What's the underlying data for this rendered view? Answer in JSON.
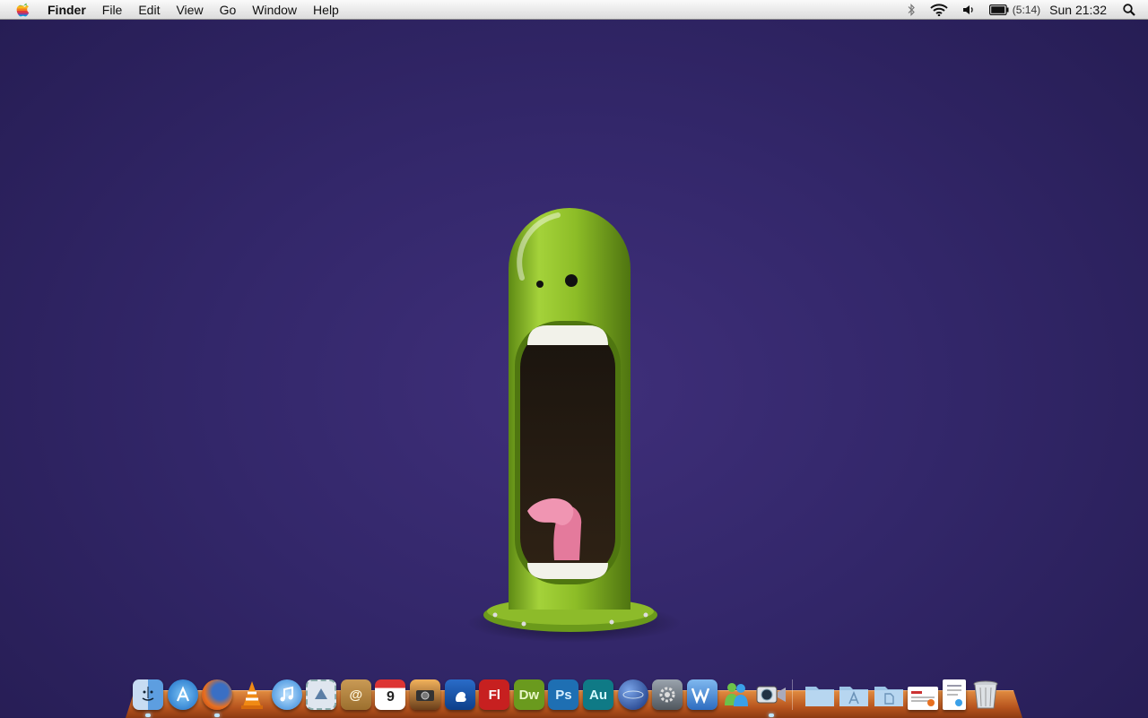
{
  "menubar": {
    "app_name": "Finder",
    "items": [
      "File",
      "Edit",
      "View",
      "Go",
      "Window",
      "Help"
    ],
    "status": {
      "battery_time": "(5:14)",
      "clock": "Sun 21:32"
    }
  },
  "dock": {
    "apps": [
      {
        "name": "Finder",
        "icon": "finder-icon"
      },
      {
        "name": "App Store",
        "icon": "app-store-icon"
      },
      {
        "name": "Firefox",
        "icon": "firefox-icon"
      },
      {
        "name": "VLC",
        "icon": "vlc-cone-icon"
      },
      {
        "name": "iTunes",
        "icon": "itunes-icon"
      },
      {
        "name": "Mail",
        "icon": "mail-stamp-icon"
      },
      {
        "name": "Address Book",
        "icon": "address-book-icon",
        "label": "@"
      },
      {
        "name": "iCal",
        "icon": "calendar-icon",
        "label": "9"
      },
      {
        "name": "iPhoto",
        "icon": "iphoto-icon"
      },
      {
        "name": "Cyberduck",
        "icon": "cyberduck-icon"
      },
      {
        "name": "Flash",
        "icon": "flash-icon",
        "label": "Fl"
      },
      {
        "name": "Dreamweaver",
        "icon": "dreamweaver-icon",
        "label": "Dw"
      },
      {
        "name": "Photoshop",
        "icon": "photoshop-icon",
        "label": "Ps"
      },
      {
        "name": "Audition",
        "icon": "audition-icon",
        "label": "Au"
      },
      {
        "name": "Network Utility",
        "icon": "globe-icon"
      },
      {
        "name": "System Preferences",
        "icon": "gear-icon"
      },
      {
        "name": "Word",
        "icon": "word-icon"
      },
      {
        "name": "Messenger",
        "icon": "messenger-icon"
      },
      {
        "name": "FaceTime",
        "icon": "camera-icon"
      }
    ],
    "stacks": [
      {
        "name": "Documents",
        "icon": "folder-icon"
      },
      {
        "name": "Applications",
        "icon": "applications-folder-icon"
      },
      {
        "name": "Files",
        "icon": "files-folder-icon"
      },
      {
        "name": "Web page",
        "icon": "webpage-doc-icon"
      },
      {
        "name": "Document",
        "icon": "document-icon"
      },
      {
        "name": "Trash",
        "icon": "trash-icon"
      }
    ],
    "colors": {
      "flash": "#c72020",
      "dreamweaver": "#6a9a1e",
      "photoshop": "#1e6fb3",
      "audition": "#0f7a86"
    }
  }
}
